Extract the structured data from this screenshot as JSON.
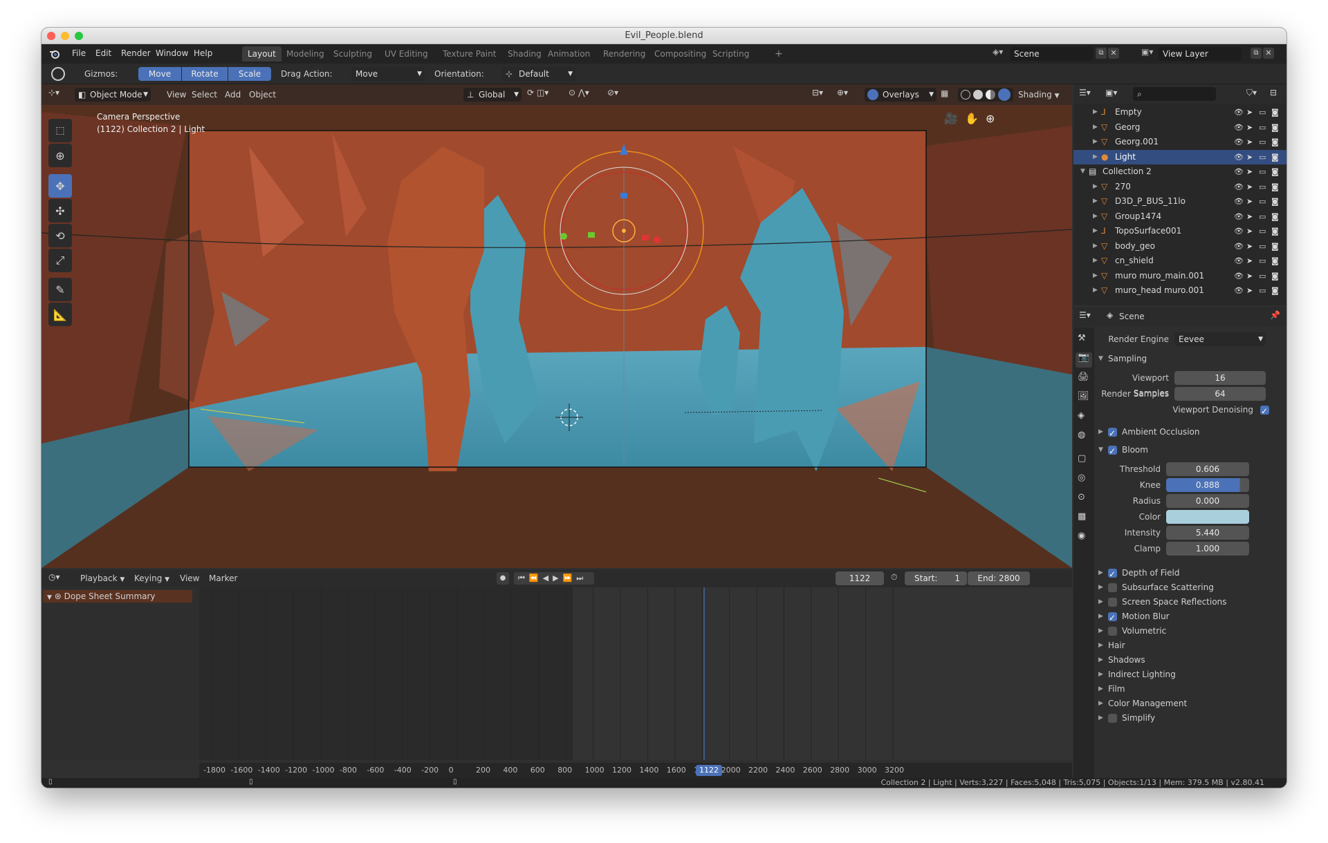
{
  "window": {
    "title": "Evil_People.blend"
  },
  "menu": {
    "file": "File",
    "edit": "Edit",
    "render": "Render",
    "window": "Window",
    "help": "Help"
  },
  "workspaces": [
    "Layout",
    "Modeling",
    "Sculpting",
    "UV Editing",
    "Texture Paint",
    "Shading",
    "Animation",
    "Rendering",
    "Compositing",
    "Scripting"
  ],
  "active_workspace": "Layout",
  "scene_field": "Scene",
  "view_layer_field": "View Layer",
  "tool_header": {
    "gizmos_label": "Gizmos:",
    "move": "Move",
    "rotate": "Rotate",
    "scale": "Scale",
    "drag_action_label": "Drag Action:",
    "drag_action_value": "Move",
    "orientation_label": "Orientation:",
    "orientation_value": "Default"
  },
  "viewport": {
    "mode": "Object Mode",
    "menus": {
      "view": "View",
      "select": "Select",
      "add": "Add",
      "object": "Object"
    },
    "transform_orientation": "Global",
    "overlays": "Overlays",
    "shading": "Shading",
    "info_line1": "Camera Perspective",
    "info_line2": "(1122) Collection 2 | Light"
  },
  "outliner": {
    "rows": [
      {
        "name": "Empty",
        "indent": 1,
        "icon": "empty-icon",
        "selected": false
      },
      {
        "name": "Georg",
        "indent": 1,
        "icon": "mesh-icon",
        "selected": false
      },
      {
        "name": "Georg.001",
        "indent": 1,
        "icon": "mesh-icon",
        "selected": false
      },
      {
        "name": "Light",
        "indent": 1,
        "icon": "light-icon",
        "selected": true
      },
      {
        "name": "Collection 2",
        "indent": 0,
        "icon": "collection-icon",
        "selected": false
      },
      {
        "name": "270",
        "indent": 1,
        "icon": "mesh-icon",
        "selected": false
      },
      {
        "name": "D3D_P_BUS_11lo",
        "indent": 1,
        "icon": "mesh-icon",
        "selected": false
      },
      {
        "name": "Group1474",
        "indent": 1,
        "icon": "mesh-icon",
        "selected": false
      },
      {
        "name": "TopoSurface001",
        "indent": 1,
        "icon": "empty-icon",
        "selected": false
      },
      {
        "name": "body_geo",
        "indent": 1,
        "icon": "mesh-icon",
        "selected": false
      },
      {
        "name": "cn_shield",
        "indent": 1,
        "icon": "mesh-icon",
        "selected": false
      },
      {
        "name": "muro muro_main.001",
        "indent": 1,
        "icon": "mesh-icon",
        "selected": false
      },
      {
        "name": "muro_head muro.001",
        "indent": 1,
        "icon": "mesh-icon",
        "selected": false
      }
    ]
  },
  "properties": {
    "context": "Scene",
    "render_engine_label": "Render Engine",
    "render_engine_value": "Eevee",
    "sampling": {
      "title": "Sampling",
      "viewport_samples_label": "Viewport Samples",
      "viewport_samples": "16",
      "render_samples_label": "Render Samples",
      "render_samples": "64",
      "viewport_denoising_label": "Viewport Denoising",
      "viewport_denoising": true
    },
    "ambient_occlusion": {
      "title": "Ambient Occlusion",
      "checked": true
    },
    "bloom": {
      "title": "Bloom",
      "checked": true,
      "threshold_label": "Threshold",
      "threshold": "0.606",
      "knee_label": "Knee",
      "knee": "0.888",
      "radius_label": "Radius",
      "radius": "0.000",
      "color_label": "Color",
      "color": "#a9cfdc",
      "intensity_label": "Intensity",
      "intensity": "5.440",
      "clamp_label": "Clamp",
      "clamp": "1.000"
    },
    "panels": [
      {
        "title": "Depth of Field",
        "checkbox": true,
        "checked": true
      },
      {
        "title": "Subsurface Scattering",
        "checkbox": true,
        "checked": false
      },
      {
        "title": "Screen Space Reflections",
        "checkbox": true,
        "checked": false
      },
      {
        "title": "Motion Blur",
        "checkbox": true,
        "checked": true
      },
      {
        "title": "Volumetric",
        "checkbox": true,
        "checked": false
      },
      {
        "title": "Hair",
        "checkbox": false,
        "checked": false
      },
      {
        "title": "Shadows",
        "checkbox": false,
        "checked": false
      },
      {
        "title": "Indirect Lighting",
        "checkbox": false,
        "checked": false
      },
      {
        "title": "Film",
        "checkbox": false,
        "checked": false
      },
      {
        "title": "Color Management",
        "checkbox": false,
        "checked": false
      },
      {
        "title": "Simplify",
        "checkbox": true,
        "checked": false
      }
    ]
  },
  "timeline": {
    "playback": "Playback",
    "keying": "Keying",
    "view": "View",
    "marker": "Marker",
    "current_frame": "1122",
    "start": "Start:",
    "start_value": "1",
    "end": "End: 2800",
    "channel": "Dope Sheet Summary",
    "ruler": [
      "-1800",
      "-1600",
      "-1400",
      "-1200",
      "-1000",
      "-800",
      "-600",
      "-400",
      "-200",
      "0",
      "200",
      "400",
      "600",
      "800",
      "1000",
      "1200",
      "1400",
      "1600",
      "1800",
      "2000",
      "2200",
      "2400",
      "2600",
      "2800",
      "3000",
      "3200"
    ]
  },
  "status": {
    "text": "Collection 2 | Light | Verts:3,227 | Faces:5,048 | Tris:5,075 | Objects:1/13 | Mem: 379.5 MB | v2.80.41"
  },
  "colors": {
    "accent": "#4b72b8",
    "outliner_selected": "#334d80",
    "object_orange": "#e08a3a",
    "viewport_red": "#a24a30",
    "viewport_teal": "#3f8ea6"
  }
}
